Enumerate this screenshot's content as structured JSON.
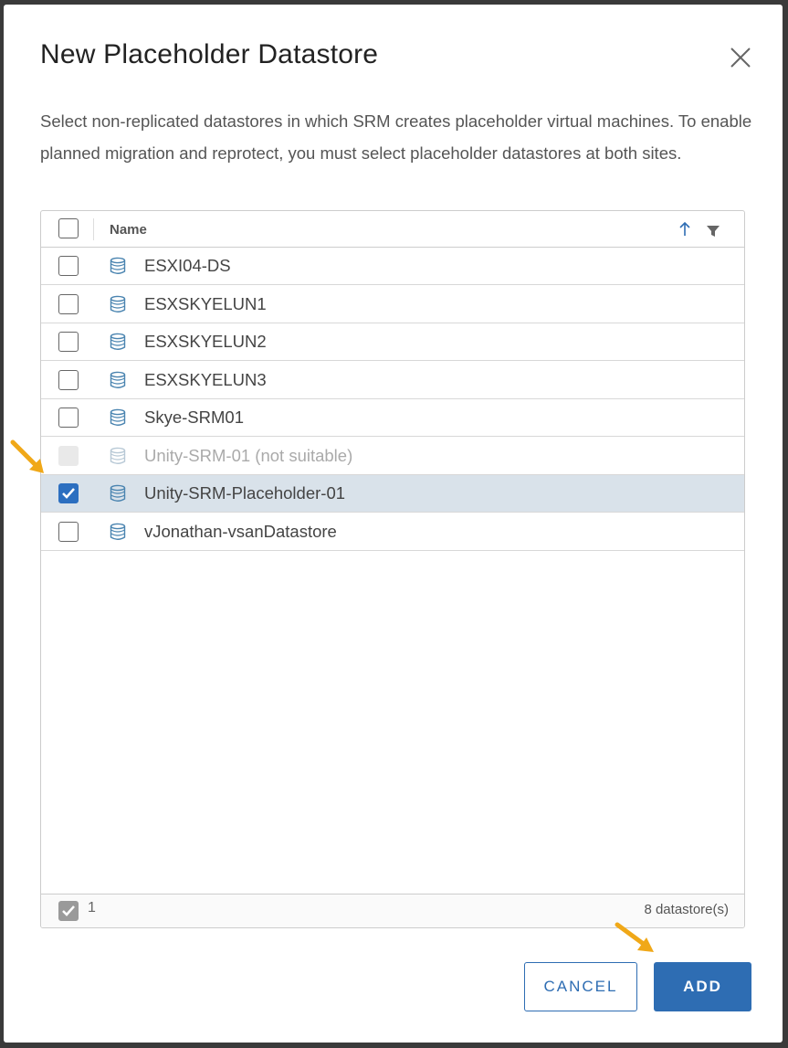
{
  "dialog": {
    "title": "New Placeholder Datastore",
    "description": "Select non-replicated datastores in which SRM creates placeholder virtual machines. To enable planned migration and reprotect, you must select placeholder datastores at both sites."
  },
  "grid": {
    "column_name": "Name",
    "sort": "ascending",
    "rows": [
      {
        "label": "ESXI04-DS",
        "checked": false,
        "disabled": false
      },
      {
        "label": "ESXSKYELUN1",
        "checked": false,
        "disabled": false
      },
      {
        "label": "ESXSKYELUN2",
        "checked": false,
        "disabled": false
      },
      {
        "label": "ESXSKYELUN3",
        "checked": false,
        "disabled": false
      },
      {
        "label": "Skye-SRM01",
        "checked": false,
        "disabled": false
      },
      {
        "label": "Unity-SRM-01 (not suitable)",
        "checked": false,
        "disabled": true
      },
      {
        "label": "Unity-SRM-Placeholder-01",
        "checked": true,
        "disabled": false
      },
      {
        "label": "vJonathan-vsanDatastore",
        "checked": false,
        "disabled": false
      }
    ],
    "footer": {
      "selected_count": "1",
      "total_label": "8 datastore(s)"
    }
  },
  "buttons": {
    "cancel_label": "CANCEL",
    "add_label": "ADD"
  },
  "icons": {
    "close": "close-icon",
    "sort": "sort-ascending-icon",
    "filter": "filter-icon",
    "datastore": "datastore-icon",
    "annotation": "arrow-pointer-icon"
  },
  "colors": {
    "accent": "#2e6db3",
    "selected_row": "#d9e2ea",
    "annotation_arrow": "#f0a818"
  }
}
